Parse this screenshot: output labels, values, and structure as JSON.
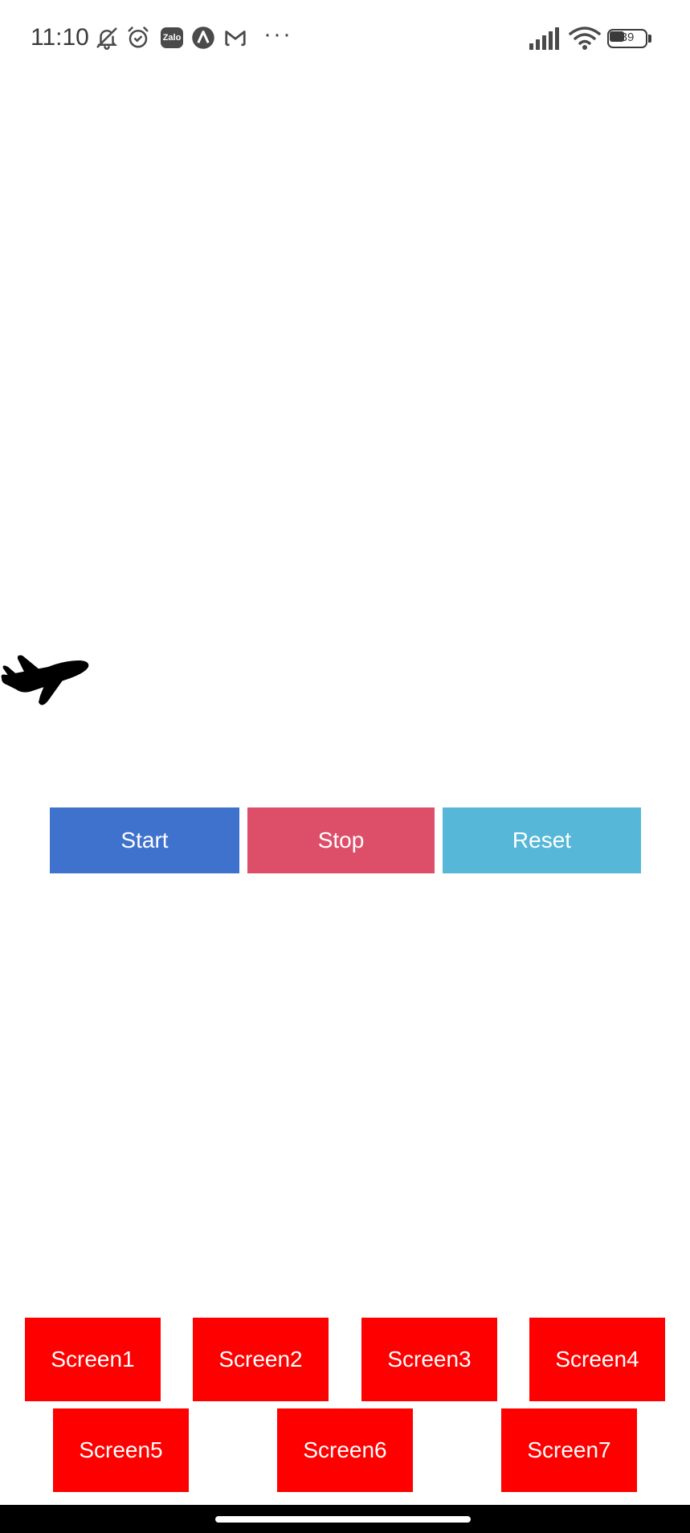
{
  "status_bar": {
    "time": "11:10",
    "battery": "39",
    "more": "···",
    "zalo_label": "Zalo",
    "icons": [
      "bell-off-icon",
      "alarm-icon",
      "zalo-icon",
      "app-a-icon",
      "gmail-icon",
      "more-icon",
      "signal-icon",
      "wifi-icon",
      "battery-icon"
    ]
  },
  "canvas": {
    "airplane_icon": "airplane-icon"
  },
  "controls": {
    "start_label": "Start",
    "stop_label": "Stop",
    "reset_label": "Reset",
    "colors": {
      "start": "#3f72cd",
      "stop": "#dd4f69",
      "reset": "#56b7d8"
    }
  },
  "screens": {
    "labels": [
      "Screen1",
      "Screen2",
      "Screen3",
      "Screen4",
      "Screen5",
      "Screen6",
      "Screen7"
    ],
    "color": "#ff0000"
  }
}
